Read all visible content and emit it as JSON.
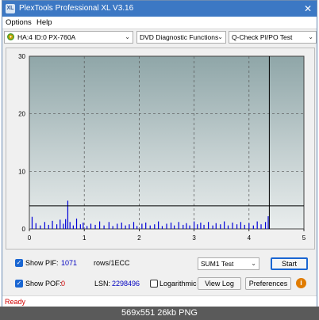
{
  "window": {
    "title": "PlexTools Professional XL V3.16",
    "icon_text": "XL",
    "close_glyph": "✕"
  },
  "menu": [
    "Options",
    "Help"
  ],
  "toolbar": {
    "drive": "HA:4 ID:0  PX-760A",
    "function": "DVD Diagnostic Functions",
    "test": "Q-Check PI/PO Test"
  },
  "chart_data": {
    "type": "bar",
    "y_ticks": [
      "30",
      "20",
      "10",
      "0"
    ],
    "x_ticks": [
      "0",
      "1",
      "2",
      "3",
      "4",
      "5"
    ],
    "xlim": [
      0,
      5
    ],
    "ylim": [
      0,
      30
    ],
    "threshold_line": 4,
    "end_marker_x": 4.37,
    "grid": true,
    "bars": [
      {
        "x": 0.05,
        "y": 2.1
      },
      {
        "x": 0.12,
        "y": 1.0
      },
      {
        "x": 0.2,
        "y": 0.6
      },
      {
        "x": 0.28,
        "y": 1.2
      },
      {
        "x": 0.35,
        "y": 0.7
      },
      {
        "x": 0.42,
        "y": 1.4
      },
      {
        "x": 0.5,
        "y": 0.8
      },
      {
        "x": 0.56,
        "y": 1.6
      },
      {
        "x": 0.62,
        "y": 0.9
      },
      {
        "x": 0.66,
        "y": 1.7
      },
      {
        "x": 0.7,
        "y": 4.9
      },
      {
        "x": 0.74,
        "y": 1.2
      },
      {
        "x": 0.8,
        "y": 0.6
      },
      {
        "x": 0.86,
        "y": 1.8
      },
      {
        "x": 0.93,
        "y": 0.8
      },
      {
        "x": 0.98,
        "y": 1.1
      },
      {
        "x": 1.05,
        "y": 0.5
      },
      {
        "x": 1.12,
        "y": 0.9
      },
      {
        "x": 1.2,
        "y": 0.7
      },
      {
        "x": 1.28,
        "y": 1.3
      },
      {
        "x": 1.36,
        "y": 0.6
      },
      {
        "x": 1.45,
        "y": 1.2
      },
      {
        "x": 1.52,
        "y": 0.5
      },
      {
        "x": 1.6,
        "y": 0.9
      },
      {
        "x": 1.68,
        "y": 1.1
      },
      {
        "x": 1.75,
        "y": 0.6
      },
      {
        "x": 1.82,
        "y": 0.8
      },
      {
        "x": 1.9,
        "y": 1.2
      },
      {
        "x": 1.96,
        "y": 0.5
      },
      {
        "x": 2.05,
        "y": 0.9
      },
      {
        "x": 2.12,
        "y": 1.1
      },
      {
        "x": 2.2,
        "y": 0.6
      },
      {
        "x": 2.28,
        "y": 0.8
      },
      {
        "x": 2.35,
        "y": 1.3
      },
      {
        "x": 2.42,
        "y": 0.5
      },
      {
        "x": 2.5,
        "y": 0.9
      },
      {
        "x": 2.58,
        "y": 1.1
      },
      {
        "x": 2.64,
        "y": 0.6
      },
      {
        "x": 2.72,
        "y": 1.2
      },
      {
        "x": 2.8,
        "y": 0.7
      },
      {
        "x": 2.86,
        "y": 1.0
      },
      {
        "x": 2.92,
        "y": 0.6
      },
      {
        "x": 3.0,
        "y": 1.3
      },
      {
        "x": 3.06,
        "y": 0.8
      },
      {
        "x": 3.12,
        "y": 1.1
      },
      {
        "x": 3.18,
        "y": 0.7
      },
      {
        "x": 3.26,
        "y": 1.2
      },
      {
        "x": 3.34,
        "y": 0.6
      },
      {
        "x": 3.4,
        "y": 1.0
      },
      {
        "x": 3.48,
        "y": 0.8
      },
      {
        "x": 3.55,
        "y": 1.3
      },
      {
        "x": 3.62,
        "y": 0.6
      },
      {
        "x": 3.7,
        "y": 1.1
      },
      {
        "x": 3.78,
        "y": 0.8
      },
      {
        "x": 3.85,
        "y": 1.2
      },
      {
        "x": 3.92,
        "y": 0.7
      },
      {
        "x": 4.0,
        "y": 1.0
      },
      {
        "x": 4.08,
        "y": 0.6
      },
      {
        "x": 4.15,
        "y": 1.3
      },
      {
        "x": 4.22,
        "y": 0.8
      },
      {
        "x": 4.3,
        "y": 1.2
      },
      {
        "x": 4.35,
        "y": 2.2
      }
    ]
  },
  "controls": {
    "show_pif_label": "Show PIF:",
    "pif_value": "1071",
    "rows_label": "rows/1ECC",
    "sum_select": "SUM1 Test",
    "start_label": "Start",
    "show_pof_label": "Show POF:",
    "pof_value": "0",
    "lsn_label": "LSN:",
    "lsn_value": "2298496",
    "logarithmic_label": "Logarithmic",
    "view_log_label": "View Log",
    "preferences_label": "Preferences",
    "info_glyph": "i",
    "check_glyph": "✓",
    "dropdown_glyph": "⌄"
  },
  "status": {
    "text": "Ready"
  },
  "caption": {
    "text": "569x551  26kb  PNG"
  },
  "colors": {
    "bar": "#0000d8",
    "value_red": "#d00000",
    "value_blue": "#0000c0"
  }
}
